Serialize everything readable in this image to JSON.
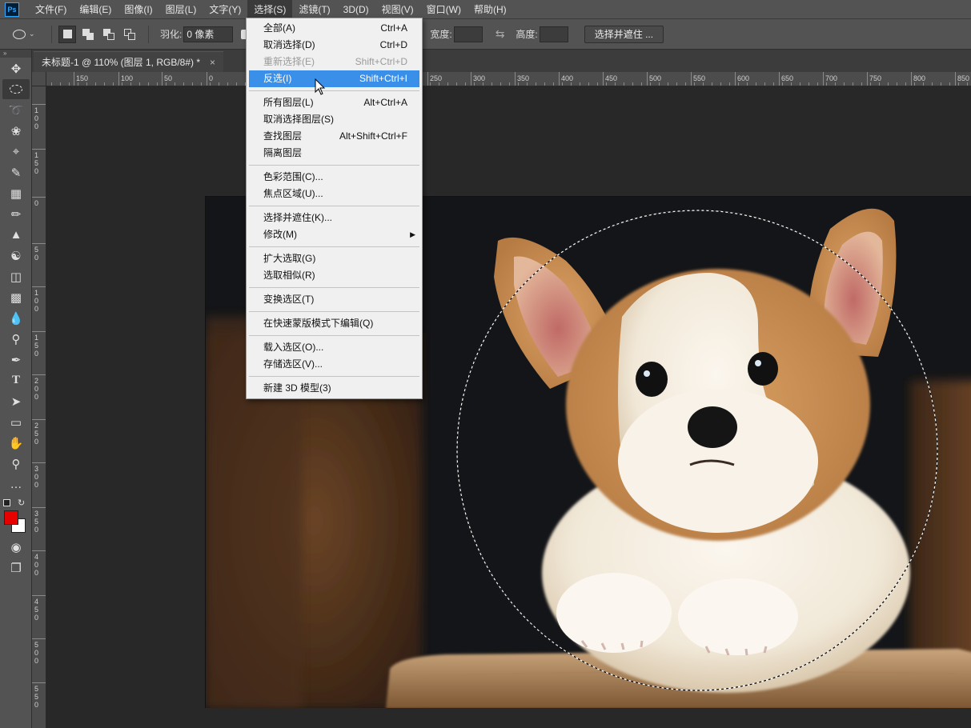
{
  "menubar": {
    "logo": "Ps",
    "items": [
      "文件(F)",
      "编辑(E)",
      "图像(I)",
      "图层(L)",
      "文字(Y)",
      "选择(S)",
      "滤镜(T)",
      "3D(D)",
      "视图(V)",
      "窗口(W)",
      "帮助(H)"
    ],
    "active_index": 5
  },
  "options": {
    "feather_label": "羽化:",
    "feather_value": "0 像素",
    "width_label": "宽度:",
    "height_label": "高度:",
    "select_mask_button": "选择并遮住 ..."
  },
  "document": {
    "tab_title": "未标题-1 @ 110% (图层 1, RGB/8#) *",
    "close": "×"
  },
  "ruler_top": {
    "labels": [
      "150",
      "100",
      "50",
      "0",
      "250",
      "300",
      "350",
      "400",
      "450",
      "500",
      "550",
      "600",
      "650",
      "700",
      "750",
      "800",
      "850"
    ]
  },
  "ruler_left": {
    "labels": [
      "100",
      "150",
      "0",
      "50",
      "100",
      "150",
      "200",
      "250",
      "300",
      "350",
      "400",
      "450",
      "500",
      "550"
    ]
  },
  "select_menu": {
    "groups": [
      [
        {
          "label": "全部(A)",
          "shortcut": "Ctrl+A",
          "state": "normal"
        },
        {
          "label": "取消选择(D)",
          "shortcut": "Ctrl+D",
          "state": "normal"
        },
        {
          "label": "重新选择(E)",
          "shortcut": "Shift+Ctrl+D",
          "state": "disabled"
        },
        {
          "label": "反选(I)",
          "shortcut": "Shift+Ctrl+I",
          "state": "highlighted"
        }
      ],
      [
        {
          "label": "所有图层(L)",
          "shortcut": "Alt+Ctrl+A",
          "state": "normal"
        },
        {
          "label": "取消选择图层(S)",
          "shortcut": "",
          "state": "normal"
        },
        {
          "label": "查找图层",
          "shortcut": "Alt+Shift+Ctrl+F",
          "state": "normal"
        },
        {
          "label": "隔离图层",
          "shortcut": "",
          "state": "normal"
        }
      ],
      [
        {
          "label": "色彩范围(C)...",
          "shortcut": "",
          "state": "normal"
        },
        {
          "label": "焦点区域(U)...",
          "shortcut": "",
          "state": "normal"
        }
      ],
      [
        {
          "label": "选择并遮住(K)...",
          "shortcut": "",
          "state": "normal"
        },
        {
          "label": "修改(M)",
          "shortcut": "",
          "state": "submenu"
        }
      ],
      [
        {
          "label": "扩大选取(G)",
          "shortcut": "",
          "state": "normal"
        },
        {
          "label": "选取相似(R)",
          "shortcut": "",
          "state": "normal"
        }
      ],
      [
        {
          "label": "变换选区(T)",
          "shortcut": "",
          "state": "normal"
        }
      ],
      [
        {
          "label": "在快速蒙版模式下编辑(Q)",
          "shortcut": "",
          "state": "normal"
        }
      ],
      [
        {
          "label": "载入选区(O)...",
          "shortcut": "",
          "state": "normal"
        },
        {
          "label": "存储选区(V)...",
          "shortcut": "",
          "state": "normal"
        }
      ],
      [
        {
          "label": "新建 3D 模型(3)",
          "shortcut": "",
          "state": "normal"
        }
      ]
    ]
  },
  "tools": [
    "move-icon",
    "elliptical-marquee-icon",
    "lasso-icon",
    "quick-select-icon",
    "crop-icon",
    "eyedropper-icon",
    "healing-brush-icon",
    "brush-icon",
    "clone-stamp-icon",
    "history-brush-icon",
    "eraser-icon",
    "gradient-icon",
    "blur-icon",
    "dodge-icon",
    "pen-icon",
    "type-icon",
    "path-select-icon",
    "rectangle-icon",
    "hand-icon",
    "zoom-icon",
    "more-icon"
  ],
  "colors": {
    "foreground": "#e60000",
    "background": "#ffffff",
    "menu_highlight": "#3a8fe8"
  }
}
